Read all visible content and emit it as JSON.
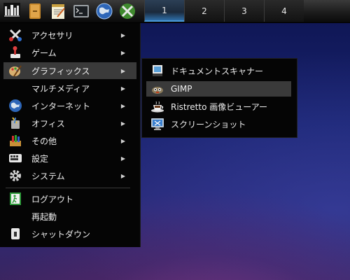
{
  "panel": {
    "launchers": [
      {
        "icon": "ubuntu-logo-icon"
      },
      {
        "icon": "file-manager-icon"
      },
      {
        "icon": "text-editor-icon"
      },
      {
        "icon": "terminal-icon"
      },
      {
        "icon": "web-browser-icon"
      },
      {
        "icon": "system-tool-icon"
      }
    ],
    "workspaces": [
      "1",
      "2",
      "3",
      "4"
    ],
    "active_workspace": "1"
  },
  "menu": {
    "items": [
      {
        "label": "アクセサリ",
        "icon": "accessories-icon",
        "submenu": true
      },
      {
        "label": "ゲーム",
        "icon": "games-icon",
        "submenu": true
      },
      {
        "label": "グラフィックス",
        "icon": "graphics-icon",
        "submenu": true,
        "selected": true
      },
      {
        "label": "マルチメディア",
        "icon": "",
        "submenu": true
      },
      {
        "label": "インターネット",
        "icon": "internet-icon",
        "submenu": true
      },
      {
        "label": "オフィス",
        "icon": "office-icon",
        "submenu": true
      },
      {
        "label": "その他",
        "icon": "other-icon",
        "submenu": true
      },
      {
        "label": "設定",
        "icon": "settings-icon",
        "submenu": true
      },
      {
        "label": "システム",
        "icon": "system-icon",
        "submenu": true
      },
      {
        "label": "ログアウト",
        "icon": "logout-icon",
        "submenu": false
      },
      {
        "label": "再起動",
        "icon": "",
        "submenu": false
      },
      {
        "label": "シャットダウン",
        "icon": "shutdown-icon",
        "submenu": false
      }
    ],
    "arrow_glyph": "▶"
  },
  "submenu": {
    "items": [
      {
        "label": "ドキュメントスキャナー",
        "icon": "scanner-icon"
      },
      {
        "label": "GIMP",
        "icon": "gimp-icon",
        "selected": true
      },
      {
        "label": "Ristretto 画像ビューアー",
        "icon": "image-viewer-icon"
      },
      {
        "label": "スクリーンショット",
        "icon": "screenshot-icon"
      }
    ]
  },
  "colors": {
    "menu_bg": "#050505",
    "menu_selected": "#3a3a3a",
    "text": "#eeeeee",
    "workspace_accent": "#4a9ad8"
  }
}
